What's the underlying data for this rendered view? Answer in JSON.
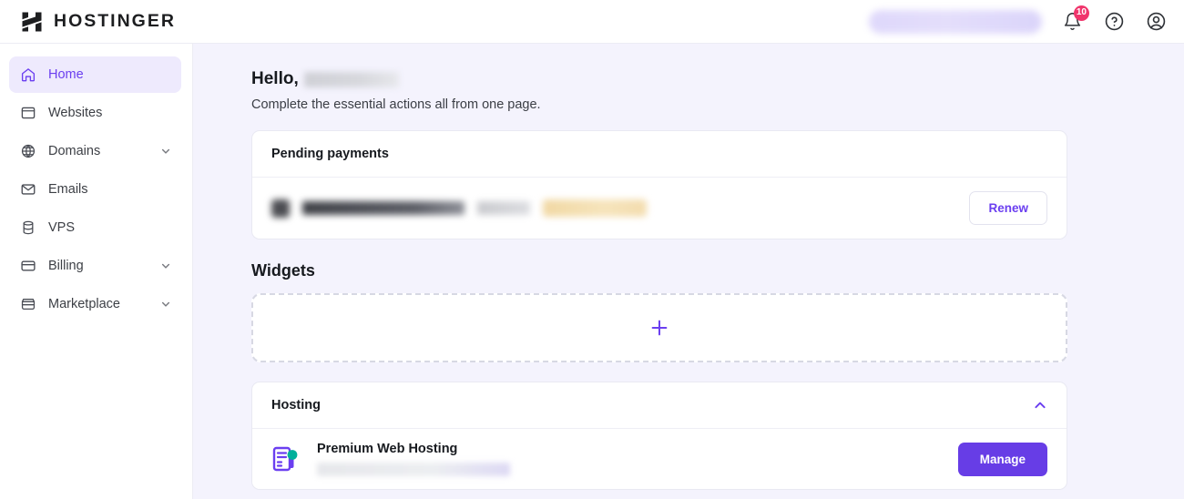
{
  "brand": {
    "name": "HOSTINGER",
    "logo_icon": "hostinger-h-logo"
  },
  "header": {
    "search_placeholder": "",
    "notifications": {
      "icon": "bell-icon",
      "count": "10",
      "badge_color": "#f0356c"
    },
    "help": {
      "icon": "question-circle-icon"
    },
    "account": {
      "icon": "user-circle-icon"
    }
  },
  "sidebar": {
    "items": [
      {
        "label": "Home",
        "icon": "home-icon",
        "active": true,
        "expandable": false
      },
      {
        "label": "Websites",
        "icon": "window-icon",
        "active": false,
        "expandable": false
      },
      {
        "label": "Domains",
        "icon": "globe-icon",
        "active": false,
        "expandable": true
      },
      {
        "label": "Emails",
        "icon": "envelope-icon",
        "active": false,
        "expandable": false
      },
      {
        "label": "VPS",
        "icon": "server-icon",
        "active": false,
        "expandable": false
      },
      {
        "label": "Billing",
        "icon": "credit-card-icon",
        "active": false,
        "expandable": true
      },
      {
        "label": "Marketplace",
        "icon": "storefront-icon",
        "active": false,
        "expandable": true
      }
    ]
  },
  "main": {
    "greeting_prefix": "Hello,",
    "greeting_name_redacted": true,
    "subtitle": "Complete the essential actions all from one page.",
    "pending_payments": {
      "title": "Pending payments",
      "row_redacted": true,
      "renew_label": "Renew"
    },
    "widgets": {
      "title": "Widgets",
      "add_icon": "plus-icon"
    },
    "hosting": {
      "title": "Hosting",
      "collapse_icon": "chevron-up-icon",
      "plan_icon": "hosting-server-icon",
      "plan_name": "Premium Web Hosting",
      "domain_redacted": true,
      "manage_label": "Manage"
    }
  },
  "colors": {
    "accent_purple": "#673de6",
    "link_purple": "#6b3ff0",
    "active_nav_bg": "#eeeafd",
    "page_bg": "#f4f3fd",
    "badge_pink": "#f0356c",
    "status_green": "#00b09b"
  }
}
